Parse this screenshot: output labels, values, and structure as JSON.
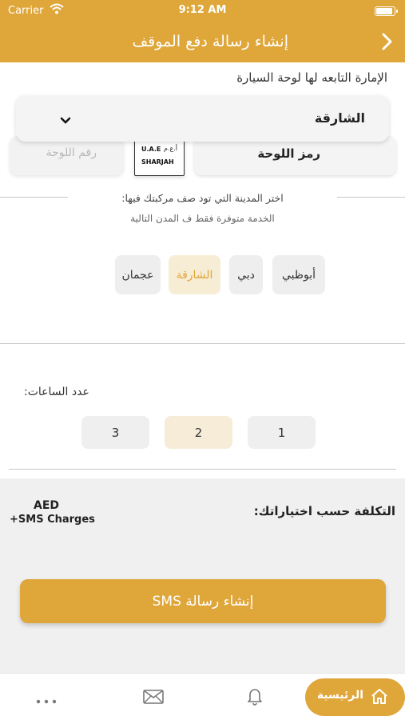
{
  "status_bar": {
    "carrier": "Carrier",
    "time": "9:12 AM"
  },
  "nav": {
    "title": "إنشاء رسالة دفع الموقف",
    "back_icon": "chevron-right-icon"
  },
  "vehicle": {
    "section_label": "الإمارة التابعه لها لوحة السيارة",
    "emirate_selected": "الشارقة",
    "plate_code_label": "رمز اللوحة",
    "plate_image": {
      "line1": "U.A.E",
      "line1_ar": "أ.ع.م",
      "line2": "SHARJAH"
    },
    "plate_number_placeholder": "رقم اللوحة"
  },
  "city": {
    "hint": "اختر المدينة التي تود صف مركبتك فيها:",
    "note": "الخدمة متوفرة فقط ف المدن التالية",
    "options": [
      "أبوظبي",
      "دبي",
      "الشارقة",
      "عجمان"
    ],
    "selected": "الشارقة"
  },
  "hours": {
    "label": "عدد الساعات:",
    "options": [
      "1",
      "2",
      "3"
    ],
    "selected": "2"
  },
  "cost": {
    "label": "التكلفة حسب اختياراتك:",
    "amount": "AED",
    "sms_note": "+SMS Charges"
  },
  "sms_button_label": "إنشاء رسالة SMS",
  "tabbar": {
    "home_label": "الرئيسية",
    "home_icon": "home-icon",
    "bell_icon": "bell-icon",
    "mail_icon": "mail-icon",
    "more_icon": "more-icon"
  },
  "colors": {
    "accent": "#dfa63a",
    "chip_selected_bg": "#f7ecd4",
    "cost_bg": "#f0f0f0"
  }
}
